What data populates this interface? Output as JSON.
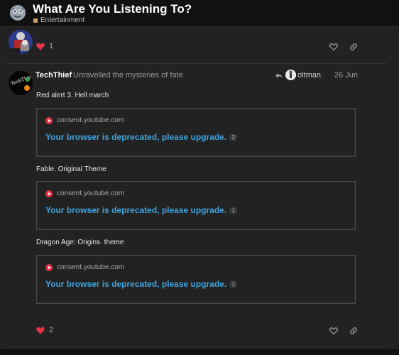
{
  "topic": {
    "title": "What Are You Listening To?",
    "category": "Entertainment",
    "category_color": "#c8a16a"
  },
  "post1": {
    "like_count": "1"
  },
  "post2": {
    "username": "TechThief",
    "user_title": "Unravelled the mysteries of fate",
    "reply_to_user": "oltman",
    "date": "26 Jun",
    "avatar_text": "TechThief",
    "songs": [
      {
        "title": "Red alert 3. Hell march",
        "onebox_domain": "consent.youtube.com",
        "onebox_title": "Your browser is deprecated, please upgrade.",
        "click_count": "2"
      },
      {
        "title": "Fable. Original Theme",
        "onebox_domain": "consent.youtube.com",
        "onebox_title": "Your browser is deprecated, please upgrade.",
        "click_count": "1"
      },
      {
        "title": "Dragon Age: Origins. theme",
        "onebox_domain": "consent.youtube.com",
        "onebox_title": "Your browser is deprecated, please upgrade.",
        "click_count": "1"
      }
    ],
    "like_count": "2"
  },
  "colors": {
    "heart": "#e8344a",
    "link": "#3fa3dd",
    "youtube": "#e8344a"
  },
  "icons": [
    "site-logo-icon",
    "heart-icon",
    "like-icon",
    "link-icon",
    "reply-arrow-icon",
    "youtube-icon"
  ]
}
